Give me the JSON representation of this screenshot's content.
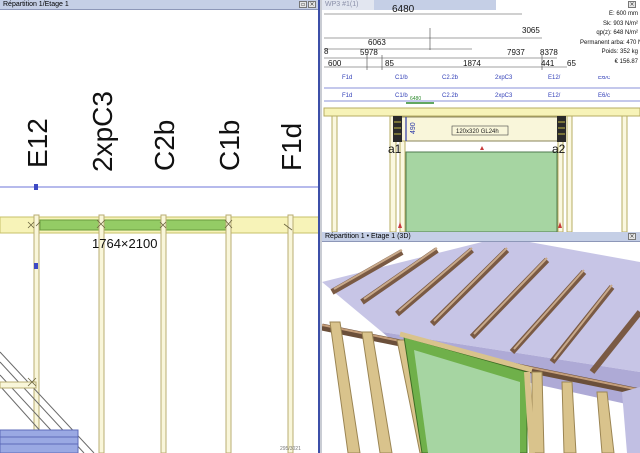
{
  "left_view": {
    "title": "Répartition 1/Etage 1",
    "wall_labels": [
      "E12",
      "2xpC3",
      "C2b",
      "C1b",
      "F1d"
    ],
    "opening_label": "1764×2100",
    "corner_note": "295/3021"
  },
  "elevation_view": {
    "title": "WP3 #1(1)",
    "dim_total": "6480",
    "dim_mid1": "3065",
    "dim_a": "6063",
    "dim_b": "5978",
    "dim_c": "7937",
    "dim_d": "8378",
    "dim_e": "8",
    "dim_f": "600",
    "dim_g": "85",
    "dim_h": "1874",
    "dim_i": "441",
    "dim_j": "65",
    "top_labels": [
      "F1d",
      "C1/b",
      "C2.2b",
      "2xpC3",
      "E12/",
      "E6/c"
    ],
    "top_labels2": [
      "F1d",
      "C1/b",
      "C2.2b",
      "2xpC3",
      "E12/",
      "E6/c"
    ],
    "beam_label": "120x320 GL24h",
    "height_mark": "490",
    "support_left": "a1",
    "support_right": "a2",
    "small_dim": "6480",
    "props": [
      "E:  600 mm",
      "Sk:  903 N/m²",
      "qp(z): 648 N/m²",
      "Permanent arba: 470 N/m²",
      "Poids:   352 kg",
      "€ 156.87"
    ]
  },
  "view3d": {
    "title": "Répartition 1 • Etage 1 (3D)"
  },
  "colors": {
    "frame_border": "#3c4fa8",
    "title_bg": "#c5cfe6",
    "beam_yellow": "#f7f3b8",
    "opening_green": "#a6d5a2",
    "timber": "#d9c38c",
    "roof_purple": "#b7b4dc",
    "blue_line": "#6d75d8"
  }
}
